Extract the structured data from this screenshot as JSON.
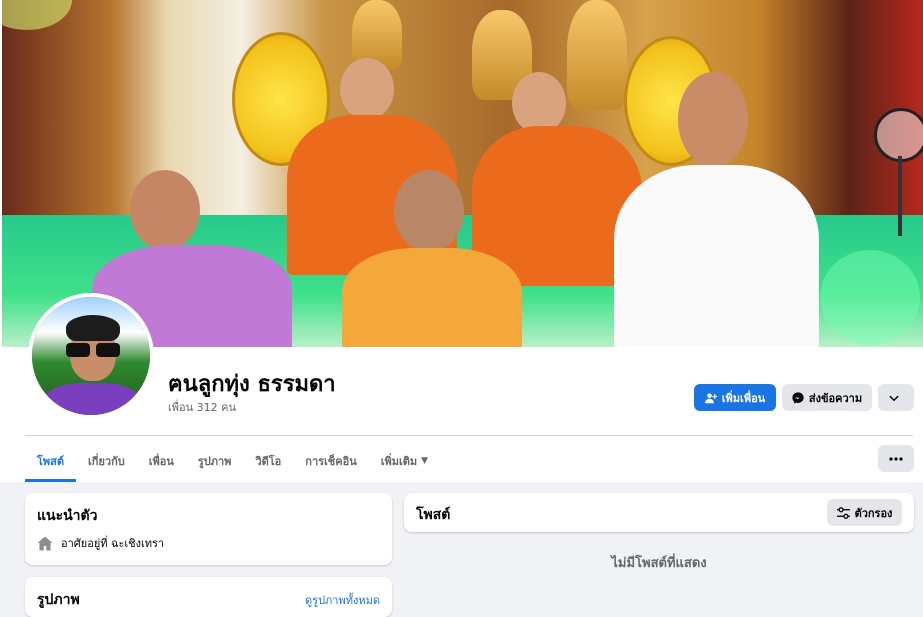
{
  "profile": {
    "name": "ฅนลูกทุ่ง ธรรมดา",
    "friends_count": "เพื่อน 312 คน"
  },
  "actions": {
    "add_friend": "เพิ่มเพื่อน",
    "message": "ส่งข้อความ"
  },
  "tabs": [
    {
      "label": "โพสต์",
      "active": true
    },
    {
      "label": "เกี่ยวกับ"
    },
    {
      "label": "เพื่อน"
    },
    {
      "label": "รูปภาพ"
    },
    {
      "label": "วิดีโอ"
    },
    {
      "label": "การเช็คอิน"
    },
    {
      "label": "เพิ่มเติม"
    }
  ],
  "intro": {
    "title": "แนะนำตัว",
    "lives_in": "อาศัยอยู่ที่ ฉะเชิงเทรา"
  },
  "photos": {
    "title": "รูปภาพ",
    "see_all": "ดูรูปภาพทั้งหมด"
  },
  "posts": {
    "title": "โพสต์",
    "filter": "ตัวกรอง",
    "empty": "ไม่มีโพสต์ที่แสดง"
  },
  "icons": [
    "add-friend-icon",
    "messenger-icon",
    "chevron-down-icon",
    "more-icon",
    "home-icon",
    "filter-icon"
  ],
  "colors": {
    "accent": "#1b74e4",
    "secondary_button": "#e4e6eb",
    "page_background": "#f0f2f5"
  }
}
